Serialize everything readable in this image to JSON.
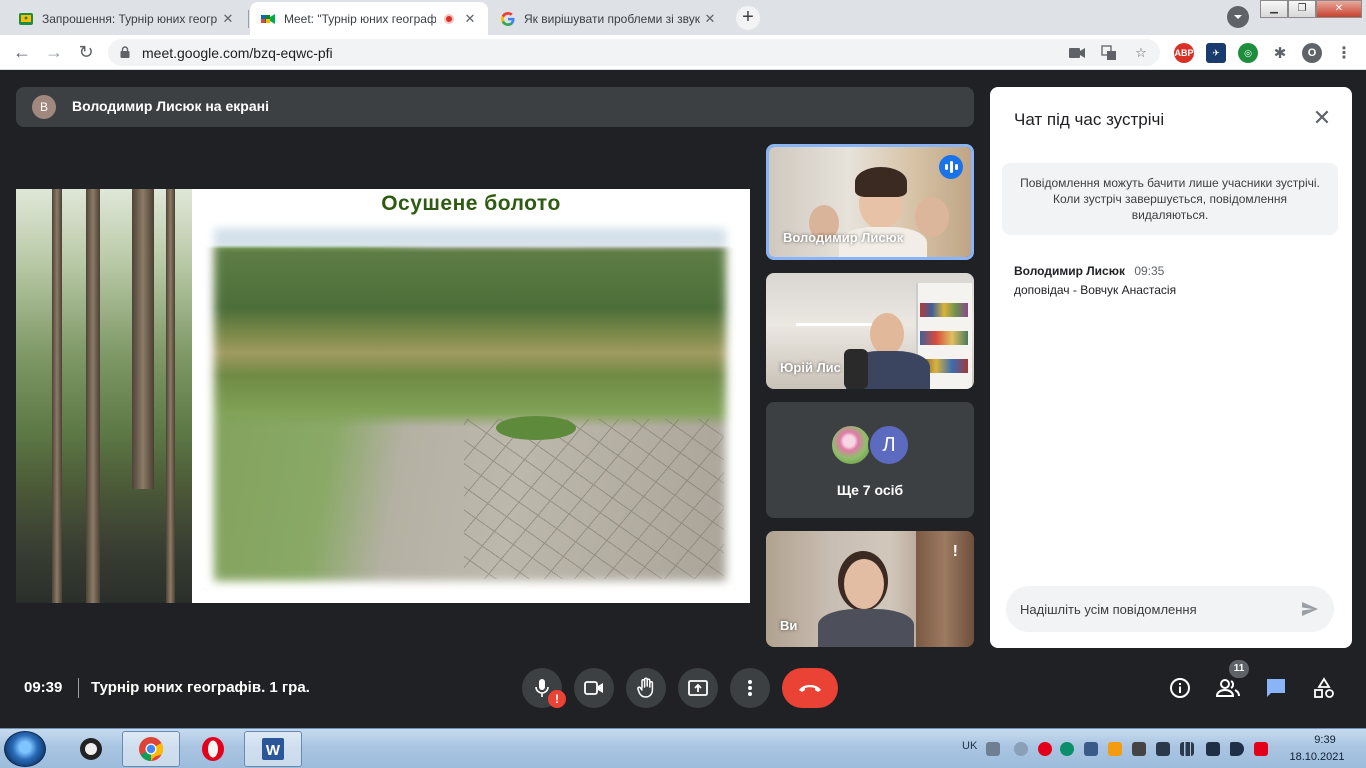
{
  "browser": {
    "tabs": [
      {
        "title": "Запрошення: Турнір юних геогр",
        "favicon": "classroom-icon"
      },
      {
        "title": "Meet: \"Турнір юних географ",
        "favicon": "meet-icon",
        "recording": true
      },
      {
        "title": "Як вирішувати проблеми зі звук",
        "favicon": "google-icon"
      }
    ],
    "url": "meet.google.com/bzq-eqwc-pfi",
    "profile_initial": "O",
    "extensions": [
      "ABP"
    ]
  },
  "presentation": {
    "presenter_initial": "В",
    "banner": "Володимир Лисюк на екрані",
    "slide_title": "Осушене болото"
  },
  "participants": [
    {
      "name": "Володимир Лисюк",
      "speaking": true
    },
    {
      "name": "Юрій Лис"
    },
    {
      "name": "Ще 7 осіб",
      "avatar_letter": "Л"
    },
    {
      "name": "Ви",
      "warning": "!"
    }
  ],
  "chat": {
    "title": "Чат під час зустрічі",
    "notice": "Повідомлення можуть бачити лише учасники зустрічі. Коли зустріч завершується, повідомлення видаляються.",
    "messages": [
      {
        "author": "Володимир Лисюк",
        "time": "09:35",
        "text": "доповідач - Вовчук Анастасія"
      }
    ],
    "input_placeholder": "Надішліть усім повідомлення"
  },
  "bottombar": {
    "time": "09:39",
    "meeting_name": "Турнір юних географів. 1 гра.",
    "mic_warning": "!",
    "participants_count": "11"
  },
  "taskbar": {
    "language": "UK",
    "time": "9:39",
    "date": "18.10.2021"
  },
  "colors": {
    "meet_bg": "#202124",
    "hangup": "#ea4335",
    "active_blue": "#8ab4f8",
    "chat_icon_blue": "#8ab4f8",
    "slide_title_green": "#2e5a12"
  }
}
